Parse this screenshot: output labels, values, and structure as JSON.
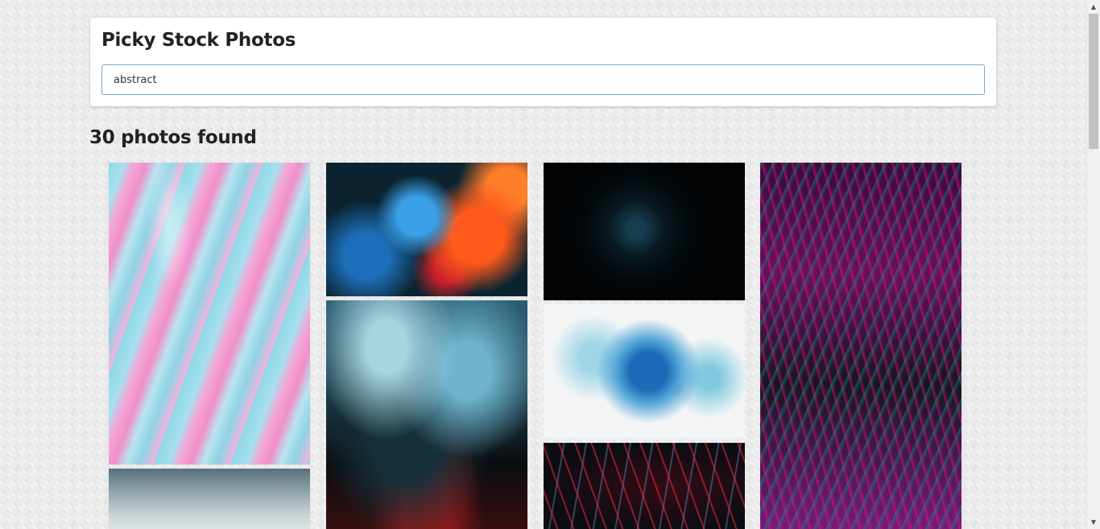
{
  "app": {
    "title": "Picky Stock Photos"
  },
  "search": {
    "value": "abstract",
    "placeholder": ""
  },
  "results": {
    "count_text": "30 photos found"
  },
  "photos": [
    {
      "subject": "pink and teal marbled paint",
      "column": 1
    },
    {
      "subject": "blue and orange ink in water",
      "column": 2
    },
    {
      "subject": "dark teal sphere pattern",
      "column": 3
    },
    {
      "subject": "magenta and teal fractal feathers",
      "column": 4
    },
    {
      "subject": "blue and black smoke explosion",
      "column": 2
    },
    {
      "subject": "blue paint splash on white",
      "column": 3
    },
    {
      "subject": "red light streaks on dark background",
      "column": 3
    },
    {
      "subject": "foggy blue-gray gradient",
      "column": 1
    }
  ],
  "icons": {
    "scroll_up": "scroll-up-arrow-icon",
    "scroll_down": "scroll-down-arrow-icon"
  },
  "colors": {
    "input_border": "#7aa7c7",
    "card_background": "#ffffff",
    "page_background": "#ebebeb"
  }
}
